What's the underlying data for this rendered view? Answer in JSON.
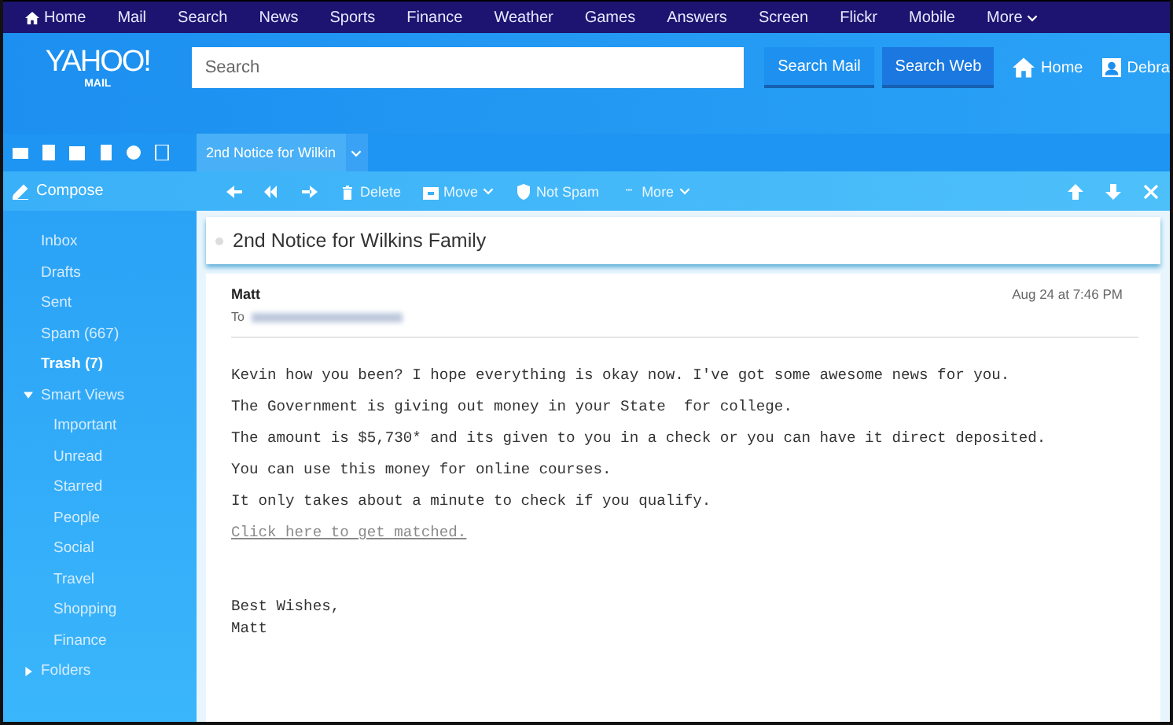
{
  "top_nav": {
    "items": [
      {
        "label": "Home",
        "kind": "home"
      },
      {
        "label": "Mail",
        "kind": "link"
      },
      {
        "label": "Search",
        "kind": "link"
      },
      {
        "label": "News",
        "kind": "link"
      },
      {
        "label": "Sports",
        "kind": "link"
      },
      {
        "label": "Finance",
        "kind": "link"
      },
      {
        "label": "Weather",
        "kind": "link"
      },
      {
        "label": "Games",
        "kind": "link"
      },
      {
        "label": "Answers",
        "kind": "link"
      },
      {
        "label": "Screen",
        "kind": "link"
      },
      {
        "label": "Flickr",
        "kind": "link"
      },
      {
        "label": "Mobile",
        "kind": "link"
      },
      {
        "label": "More",
        "kind": "menu"
      }
    ]
  },
  "header": {
    "logo": "YAHOO!",
    "logo_sub": "MAIL",
    "search": {
      "placeholder": "Search"
    },
    "buttons": [
      {
        "label": "Search Mail",
        "selected": false
      },
      {
        "label": "Search Web",
        "selected": true
      }
    ],
    "home": "Home",
    "user": "Debra"
  },
  "tabs": [
    {
      "label": "2nd Notice for Wilkin",
      "selected": true
    }
  ],
  "toolbar": {
    "compose": "Compose",
    "actions": [
      {
        "label": "Delete",
        "kind": "delete"
      },
      {
        "label": "Move",
        "kind": "move"
      },
      {
        "label": "Not Spam",
        "kind": "shield"
      },
      {
        "label": "More",
        "kind": "more"
      }
    ]
  },
  "sidebar": {
    "items": [
      {
        "label": "Inbox",
        "selected": false
      },
      {
        "label": "Drafts",
        "selected": false
      },
      {
        "label": "Sent",
        "selected": false
      },
      {
        "label": "Spam (667)",
        "selected": false
      },
      {
        "label": "Trash (7)",
        "selected": true
      },
      {
        "label": "Smart Views",
        "selected": false,
        "expanded": true,
        "children": [
          {
            "label": "Important",
            "selected": false
          },
          {
            "label": "Unread",
            "selected": false
          },
          {
            "label": "Starred",
            "selected": false
          },
          {
            "label": "People",
            "selected": false
          },
          {
            "label": "Social",
            "selected": false
          },
          {
            "label": "Travel",
            "selected": false
          },
          {
            "label": "Shopping",
            "selected": false
          },
          {
            "label": "Finance",
            "selected": false
          }
        ]
      },
      {
        "label": "Folders",
        "selected": false,
        "expanded": false
      }
    ]
  },
  "message": {
    "subject": "2nd Notice for Wilkins Family",
    "from": "Matt",
    "to_label": "To",
    "date": "Aug 24 at 7:46 PM",
    "body": [
      {
        "kind": "text",
        "text": "Kevin how you been? I hope everything is okay now. I've got some awesome news for you."
      },
      {
        "kind": "text",
        "text": "The Government is giving out money in your State  for college."
      },
      {
        "kind": "text",
        "text": "The amount is $5,730* and its given to you in a check or you can have it direct deposited."
      },
      {
        "kind": "text",
        "text": "You can use this money for online courses."
      },
      {
        "kind": "text",
        "text": "It only takes about a minute to check if you qualify."
      },
      {
        "kind": "link",
        "text": "Click here to get matched."
      }
    ],
    "signoff": [
      "Best Wishes,",
      "Matt"
    ]
  }
}
